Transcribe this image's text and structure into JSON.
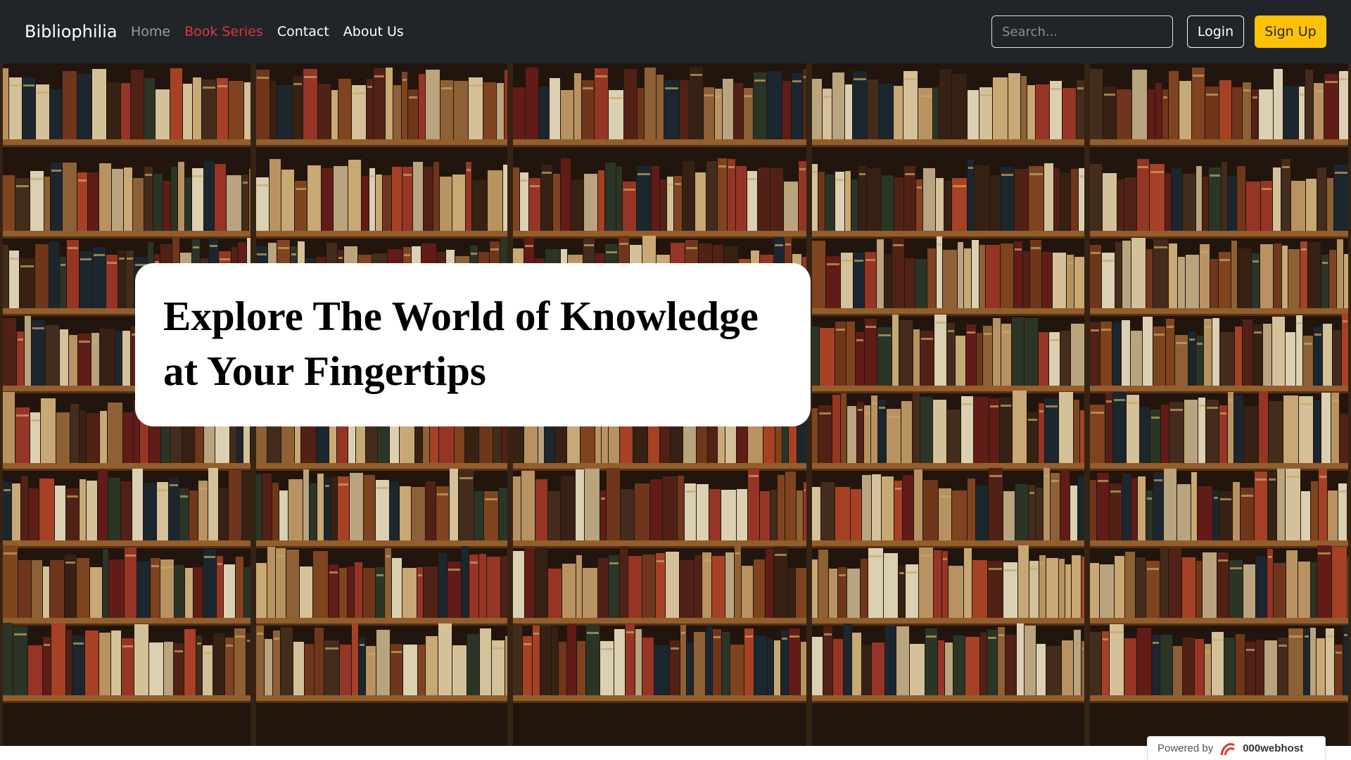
{
  "navbar": {
    "brand": "Bibliophilia",
    "links": [
      {
        "label": "Home",
        "state": "muted"
      },
      {
        "label": "Book Series",
        "state": "active"
      },
      {
        "label": "Contact",
        "state": "normal"
      },
      {
        "label": "About Us",
        "state": "normal"
      }
    ],
    "search": {
      "placeholder": "Search..."
    },
    "login_label": "Login",
    "signup_label": "Sign Up"
  },
  "hero": {
    "title_line1": "Explore The World of Knowledge",
    "title_line2": "at Your Fingertips",
    "background_image": "bookshelf photo"
  },
  "badge": {
    "powered_by": "Powered by",
    "host": "000webhost"
  },
  "colors": {
    "navbar_bg": "#212529",
    "active_link": "#dc3545",
    "signup_bg": "#ffc107",
    "shelf_wood": "#8a5a2c"
  }
}
